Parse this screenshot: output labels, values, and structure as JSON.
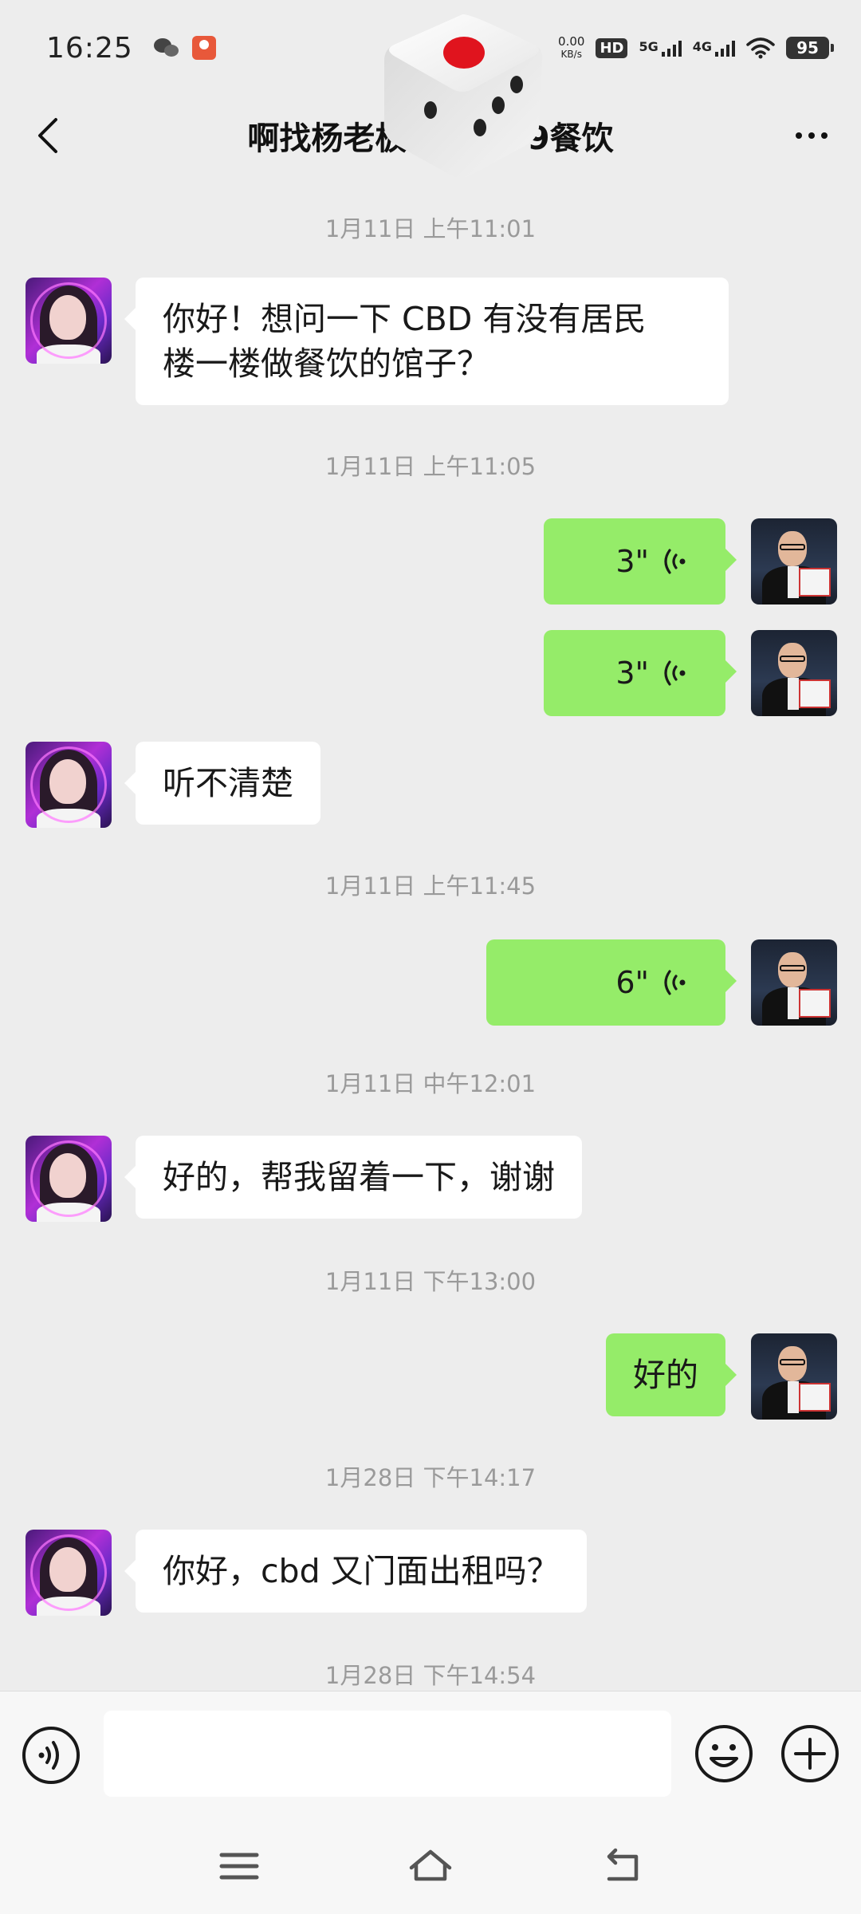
{
  "status_bar": {
    "time": "16:25",
    "net_speed_value": "0.00",
    "net_speed_unit": "KB/s",
    "hd_label": "HD",
    "sim1_label": "5G",
    "sim2_label": "4G",
    "battery": "95"
  },
  "header": {
    "title": "啊找杨老板13…599餐饮"
  },
  "messages": [
    {
      "type": "time",
      "text": "1月11日 上午11:01"
    },
    {
      "type": "text",
      "side": "left",
      "text_line1": "你好！想问一下 CBD 有没有居民",
      "text_line2": "楼一楼做餐饮的馆子？"
    },
    {
      "type": "time",
      "text": "1月11日 上午11:05"
    },
    {
      "type": "voice",
      "side": "right",
      "duration": "3\""
    },
    {
      "type": "voice",
      "side": "right",
      "duration": "3\""
    },
    {
      "type": "text",
      "side": "left",
      "text": "听不清楚"
    },
    {
      "type": "time",
      "text": "1月11日 上午11:45"
    },
    {
      "type": "voice",
      "side": "right",
      "duration": "6\""
    },
    {
      "type": "time",
      "text": "1月11日 中午12:01"
    },
    {
      "type": "text",
      "side": "left",
      "text": "好的，帮我留着一下，谢谢"
    },
    {
      "type": "time",
      "text": "1月11日 下午13:00"
    },
    {
      "type": "text",
      "side": "right",
      "text": "好的"
    },
    {
      "type": "time",
      "text": "1月28日 下午14:17"
    },
    {
      "type": "text",
      "side": "left",
      "text": "你好，cbd 又门面出租吗？"
    },
    {
      "type": "time",
      "text": "1月28日 下午14:54"
    }
  ],
  "input_bar": {
    "value": "",
    "placeholder": ""
  },
  "colors": {
    "background": "#ededed",
    "bubble_self": "#95ec69",
    "bubble_other": "#ffffff",
    "timestamp": "#9a9a9a",
    "dice_pip": "#e0141e"
  },
  "icons": {
    "back": "chevron-left-icon",
    "more": "more-dots-icon",
    "voice_toggle": "voice-icon",
    "emoji": "smiley-icon",
    "plus": "plus-circle-icon",
    "sys_menu": "menu-icon",
    "sys_home": "home-icon",
    "sys_back": "back-arrow-icon",
    "dice": "dice-icon"
  }
}
